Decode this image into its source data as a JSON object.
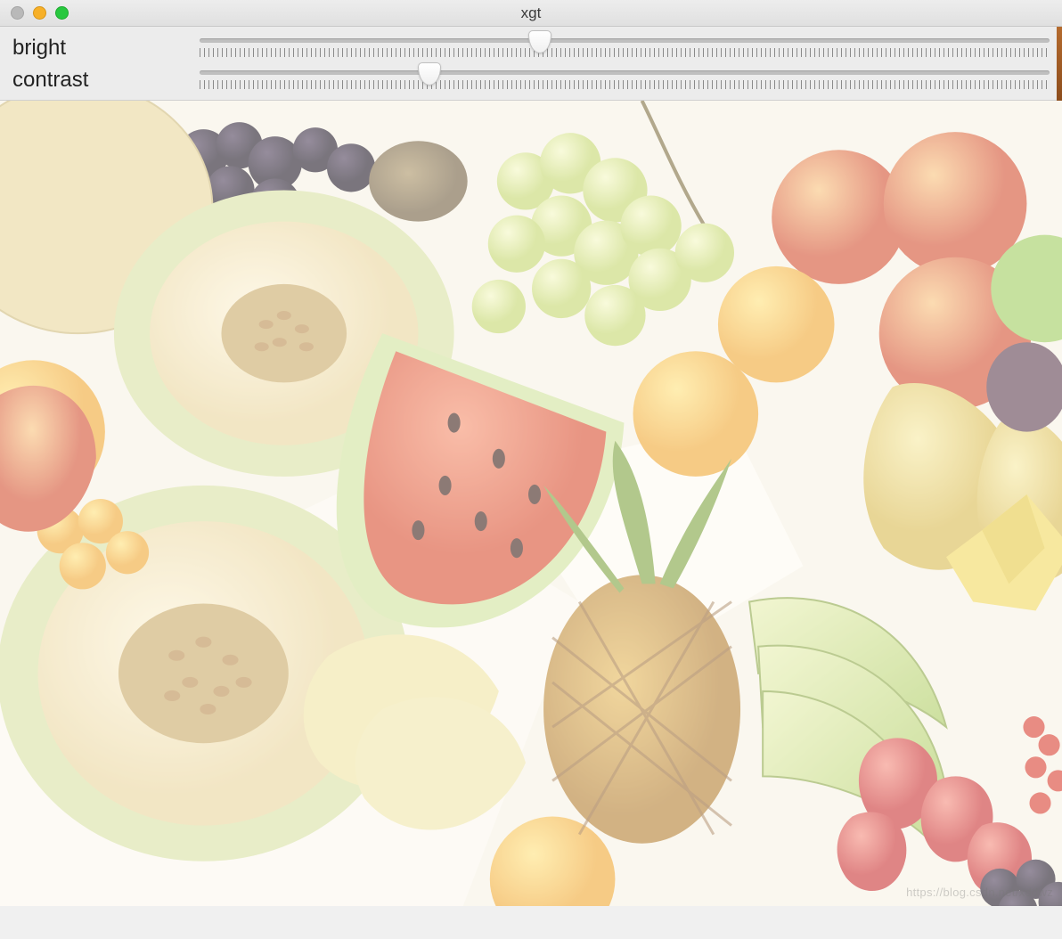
{
  "window": {
    "title": "xgt"
  },
  "sliders": {
    "bright": {
      "label": "bright",
      "value_percent": 40
    },
    "contrast": {
      "label": "contrast",
      "value_percent": 27
    }
  },
  "image": {
    "description": "assorted-fruit-photo",
    "brightness_overlay_opacity": 0.42
  },
  "watermark": {
    "text": "https://blog.csdn.net/xddwz"
  }
}
